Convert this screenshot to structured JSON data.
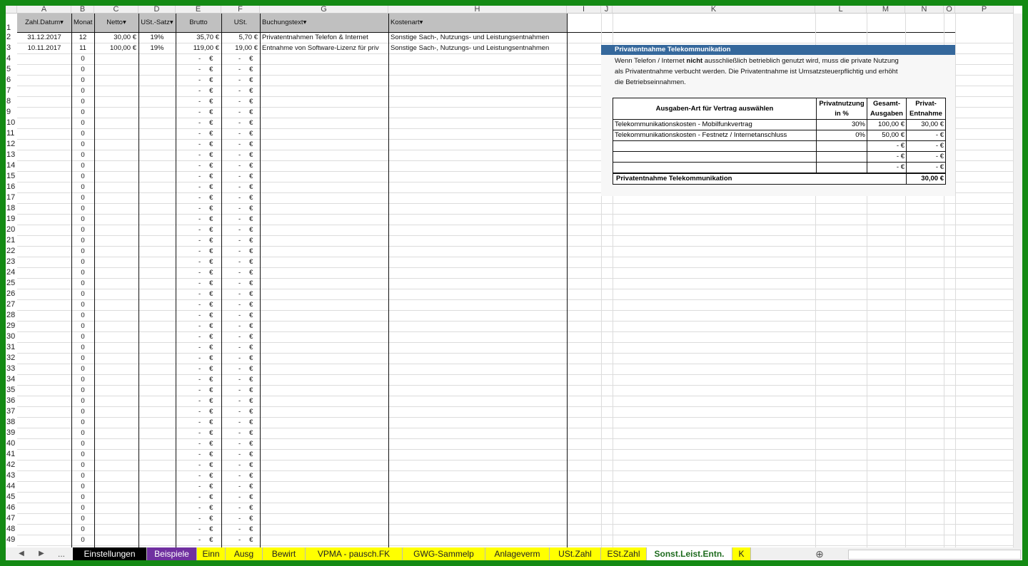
{
  "columns": [
    "A",
    "B",
    "C",
    "D",
    "E",
    "F",
    "G",
    "H",
    "I",
    "J",
    "K",
    "L",
    "M",
    "N",
    "O",
    "P"
  ],
  "headers": {
    "a": "Zahl.Datum",
    "b": "Monat",
    "c": "Netto",
    "d": "USt.-Satz",
    "e": "Brutto",
    "f": "USt.",
    "g": "Buchungstext",
    "h": "Kostenart",
    "marker": "▾"
  },
  "rows": [
    {
      "n": "2",
      "date": "31.12.2017",
      "month": "12",
      "net": "30,00 €",
      "rate": "19%",
      "gross": "35,70 €",
      "vat": "5,70 €",
      "text": "Privatentnahmen Telefon & Internet",
      "cat": "Sonstige Sach-, Nutzungs- und Leistungsentnahmen"
    },
    {
      "n": "3",
      "date": "10.11.2017",
      "month": "11",
      "net": "100,00 €",
      "rate": "19%",
      "gross": "119,00 €",
      "vat": "19,00 €",
      "text": "Entnahme von Software-Lizenz für priv",
      "cat": "Sonstige Sach-, Nutzungs- und Leistungsentnahmen"
    }
  ],
  "empty_row": {
    "month": "0",
    "dash": "-",
    "euro": "€"
  },
  "info": {
    "title": "Privatentnahme Telekommunikation",
    "line1_pre": "Wenn Telefon / Internet ",
    "line1_bold": "nicht",
    "line1_post": " ausschließlich betrieblich genutzt wird, muss die private Nutzung",
    "line2": "als Privatentnahme verbucht werden. Die Privatentnahme ist Umsatzsteuerpflichtig und erhöht",
    "line3": "die Betriebseinnahmen.",
    "table_headers": {
      "kind": "Ausgaben-Art für Vertrag auswählen",
      "priv_a": "Privatnutzung",
      "priv_b": "in %",
      "total_a": "Gesamt-",
      "total_b": "Ausgaben",
      "withdraw_a": "Privat-",
      "withdraw_b": "Entnahme"
    },
    "table_rows": [
      {
        "kind": "Telekommunikationskosten - Mobilfunkvertrag",
        "pct": "30%",
        "total": "100,00 €",
        "withdraw": "30,00 €"
      },
      {
        "kind": "Telekommunikationskosten - Festnetz / Internetanschluss",
        "pct": "0%",
        "total": "50,00 €",
        "withdraw": "-    €"
      },
      {
        "kind": "",
        "pct": "",
        "total": "-    €",
        "withdraw": "-    €"
      },
      {
        "kind": "",
        "pct": "",
        "total": "-    €",
        "withdraw": "-    €"
      },
      {
        "kind": "",
        "pct": "",
        "total": "-    €",
        "withdraw": "-    €"
      }
    ],
    "footer_label": "Privatentnahme Telekommunikation",
    "footer_value": "30,00 €"
  },
  "tabs": [
    {
      "label": "Einstellungen",
      "bg": "#000000",
      "fg": "#ffffff"
    },
    {
      "label": "Beispiele",
      "bg": "#7030a0",
      "fg": "#ffffff"
    },
    {
      "label": "Einn",
      "bg": "#ffff00",
      "fg": "#222222"
    },
    {
      "label": "Ausg",
      "bg": "#ffff00",
      "fg": "#222222"
    },
    {
      "label": "Bewirt",
      "bg": "#ffff00",
      "fg": "#222222"
    },
    {
      "label": "VPMA - pausch.FK",
      "bg": "#ffff00",
      "fg": "#222222"
    },
    {
      "label": "GWG-Sammelp",
      "bg": "#ffff00",
      "fg": "#222222"
    },
    {
      "label": "Anlageverm",
      "bg": "#ffff00",
      "fg": "#222222"
    },
    {
      "label": "USt.Zahl",
      "bg": "#ffff00",
      "fg": "#222222"
    },
    {
      "label": "ESt.Zahl",
      "bg": "#ffff00",
      "fg": "#222222"
    },
    {
      "label": "Sonst.Leist.Entn.",
      "bg": "#ffffff",
      "fg": "#1e6b1e"
    },
    {
      "label": "K",
      "bg": "#ffff00",
      "fg": "#222222"
    }
  ],
  "nav": {
    "prev": "◀",
    "next": "▶",
    "more": "...",
    "add": "⊕"
  },
  "colors": {
    "frame": "#148a14",
    "info_header": "#35689c",
    "grey_header": "#c0c0c0"
  }
}
